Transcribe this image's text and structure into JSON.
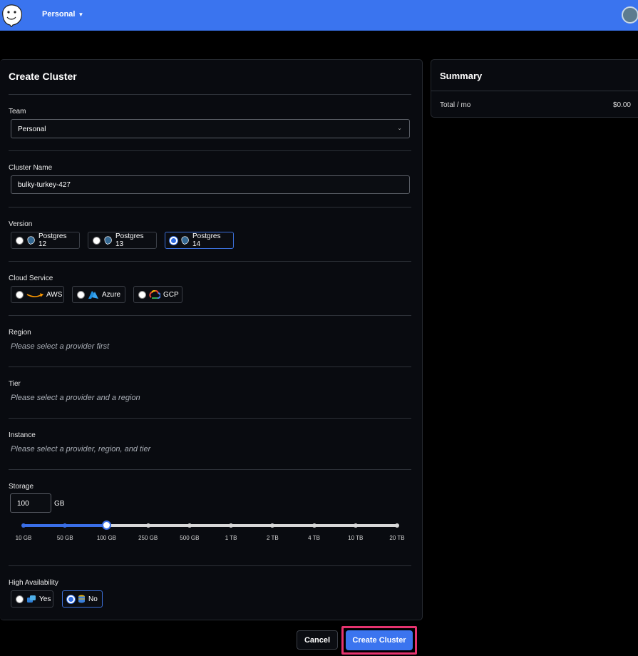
{
  "header": {
    "team_switcher_label": "Personal"
  },
  "form": {
    "title": "Create Cluster",
    "team": {
      "label": "Team",
      "value": "Personal"
    },
    "cluster_name": {
      "label": "Cluster Name",
      "value": "bulky-turkey-427"
    },
    "version": {
      "label": "Version",
      "options": [
        "Postgres 12",
        "Postgres 13",
        "Postgres 14"
      ],
      "selected": "Postgres 14"
    },
    "cloud_service": {
      "label": "Cloud Service",
      "options": [
        "AWS",
        "Azure",
        "GCP"
      ],
      "selected": null
    },
    "region": {
      "label": "Region",
      "placeholder": "Please select a provider first"
    },
    "tier": {
      "label": "Tier",
      "placeholder": "Please select a provider and a region"
    },
    "instance": {
      "label": "Instance",
      "placeholder": "Please select a provider, region, and tier"
    },
    "storage": {
      "label": "Storage",
      "value": "100",
      "unit": "GB",
      "steps": [
        "10 GB",
        "50 GB",
        "100 GB",
        "250 GB",
        "500 GB",
        "1 TB",
        "2 TB",
        "4 TB",
        "10 TB",
        "20 TB"
      ],
      "selected_index": 2
    },
    "high_availability": {
      "label": "High Availability",
      "options": [
        "Yes",
        "No"
      ],
      "selected": "No"
    }
  },
  "summary": {
    "title": "Summary",
    "total_label": "Total / mo",
    "total_value": "$0.00"
  },
  "footer": {
    "cancel_label": "Cancel",
    "create_label": "Create Cluster"
  },
  "colors": {
    "topbar": "#3a74ef",
    "accent": "#3b74ef",
    "highlight": "#e6336f"
  }
}
